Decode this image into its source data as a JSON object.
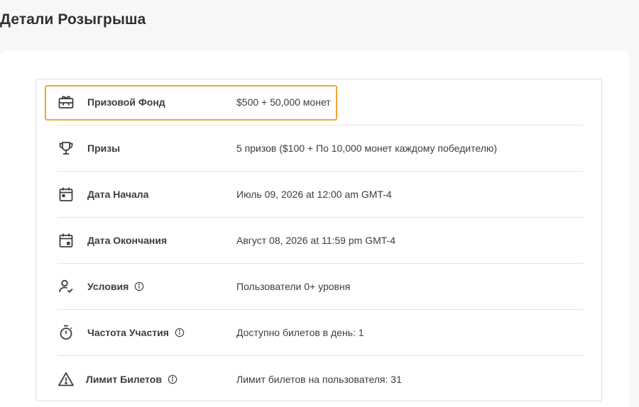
{
  "page": {
    "title": "Детали Розыгрыша"
  },
  "details": [
    {
      "icon": "gift-card-icon",
      "label": "Призовой Фонд",
      "value": "$500 + 50,000 монет",
      "info": false
    },
    {
      "icon": "trophy-icon",
      "label": "Призы",
      "value": "5 призов ($100 + По 10,000 монет каждому победителю)",
      "info": false
    },
    {
      "icon": "calendar-start-icon",
      "label": "Дата Начала",
      "value": "Июль 09, 2026 at 12:00 am GMT-4",
      "info": false
    },
    {
      "icon": "calendar-end-icon",
      "label": "Дата Окончания",
      "value": "Август 08, 2026 at 11:59 pm GMT-4",
      "info": false
    },
    {
      "icon": "user-check-icon",
      "label": "Условия",
      "value": "Пользователи 0+ уровня",
      "info": true
    },
    {
      "icon": "stopwatch-icon",
      "label": "Частота Участия",
      "value": "Доступно билетов в день: 1",
      "info": true
    },
    {
      "icon": "warning-icon",
      "label": "Лимит Билетов",
      "value": "Лимит билетов на пользователя: 31",
      "info": true
    }
  ],
  "colors": {
    "highlight": "#f5a33a",
    "background": "#f6f7f7",
    "panel": "#ffffff",
    "text": "#3d3d3d"
  }
}
